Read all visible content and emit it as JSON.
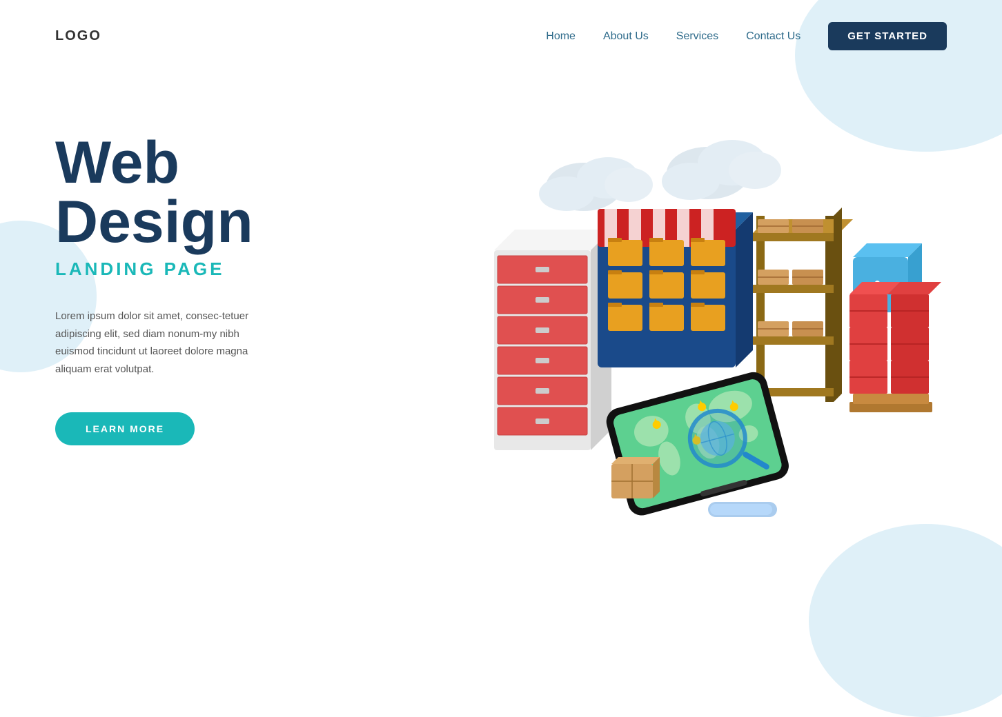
{
  "logo": {
    "text": "LOGO"
  },
  "nav": {
    "links": [
      {
        "label": "Home",
        "id": "home"
      },
      {
        "label": "About Us",
        "id": "about"
      },
      {
        "label": "Services",
        "id": "services"
      },
      {
        "label": "Contact Us",
        "id": "contact"
      }
    ],
    "cta": "GET STARTED"
  },
  "hero": {
    "title_line1": "Web",
    "title_line2": "Design",
    "subtitle": "LANDING PAGE",
    "description": "Lorem ipsum dolor sit amet, consec-tetuer adipiscing elit, sed diam nonum-my nibh euismod tincidunt ut laoreet dolore magna aliquam erat volutpat.",
    "cta": "LEARN MORE"
  }
}
